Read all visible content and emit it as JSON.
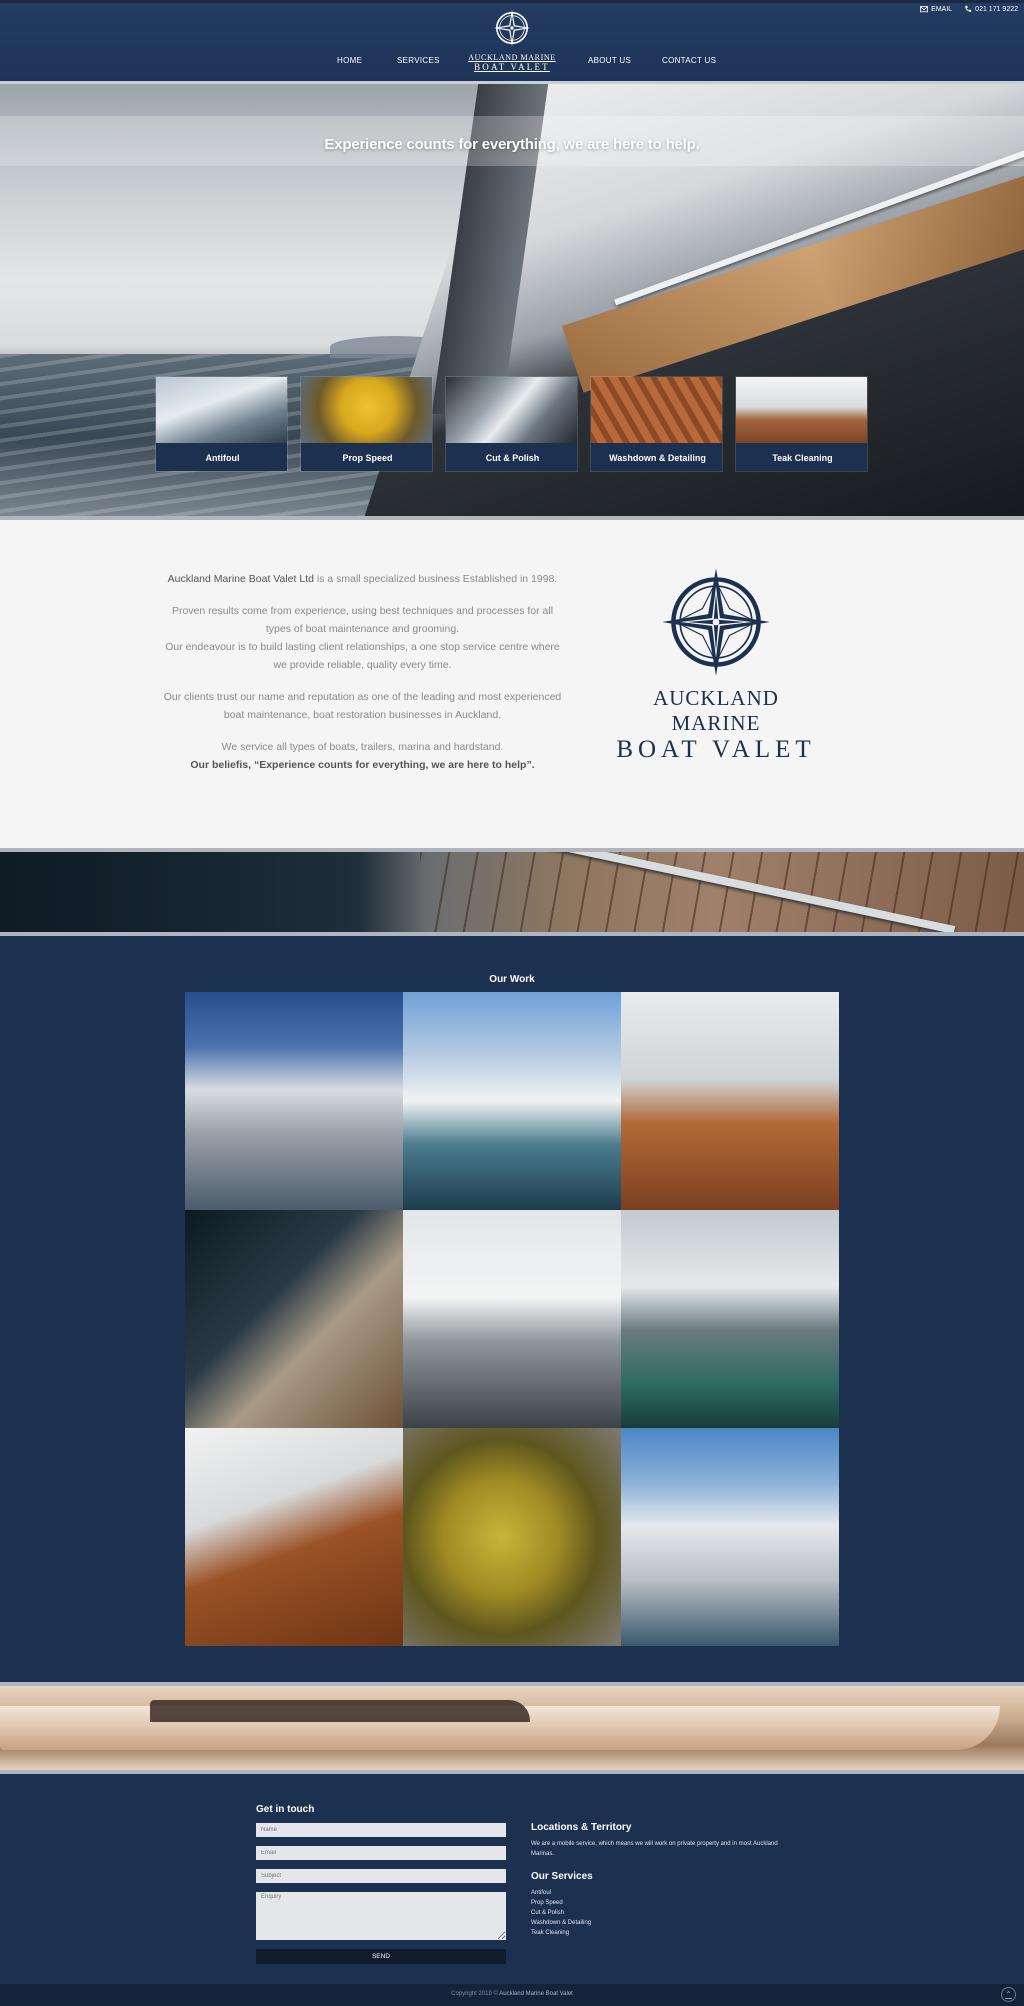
{
  "header": {
    "email_label": "EMAIL",
    "phone_label": "021 171 9222",
    "logo_line1": "AUCKLAND MARINE",
    "logo_line2": "BOAT VALET",
    "nav": [
      "HOME",
      "SERVICES",
      "ABOUT US",
      "CONTACT US"
    ]
  },
  "hero": {
    "tagline": "Experience counts for everything, we are here to help."
  },
  "services": [
    "Antifoul",
    "Prop Speed",
    "Cut & Polish",
    "Washdown & Detailing",
    "Teak Cleaning"
  ],
  "about": {
    "p1_name": "Auckland Marine Boat Valet Ltd",
    "p1_rest": " is a small specialized business Established in 1998.",
    "p2": "Proven results come from experience, using best techniques and processes for all types of boat maintenance and grooming.",
    "p3": "Our endeavour is to build lasting client relationships, a one stop service centre where we provide reliable, quality every time.",
    "p4": "Our clients trust our name and reputation as one of the leading and most experienced boat maintenance, boat restoration businesses in Auckland.",
    "p5": "We service all types of boats, trailers, marina and hardstand.",
    "p6": "Our beliefis, “Experience counts for everything, we are here to help”.",
    "logo_line1": "AUCKLAND MARINE",
    "logo_line2": "BOAT VALET"
  },
  "work": {
    "title": "Our Work"
  },
  "contact": {
    "title": "Get in touch",
    "name_placeholder": "Name",
    "email_placeholder": "Email",
    "subject_placeholder": "Subject",
    "enquiry_placeholder": "Enquiry",
    "send_label": "SEND",
    "locations_title": "Locations & Territory",
    "locations_text": "We are a mobile service, which means we will work on private property and in most Auckland Marinas.",
    "services_title": "Our Services",
    "services_list": [
      "Antifoul",
      "Prop Speed",
      "Cut & Polish",
      "Washdown & Detailing",
      "Teak Cleaning"
    ]
  },
  "footer": {
    "copyright_prefix": "Copyright 2019 © ",
    "copyright_name": "Auckland Marine Boat Valet",
    "to_top": "⌃"
  },
  "colors": {
    "navy": "#1c3050",
    "header": "#253c63",
    "button_dark": "#111c2c"
  },
  "icons": [
    "envelope-icon",
    "phone-icon",
    "compass-rose-logo",
    "back-to-top-icon"
  ]
}
